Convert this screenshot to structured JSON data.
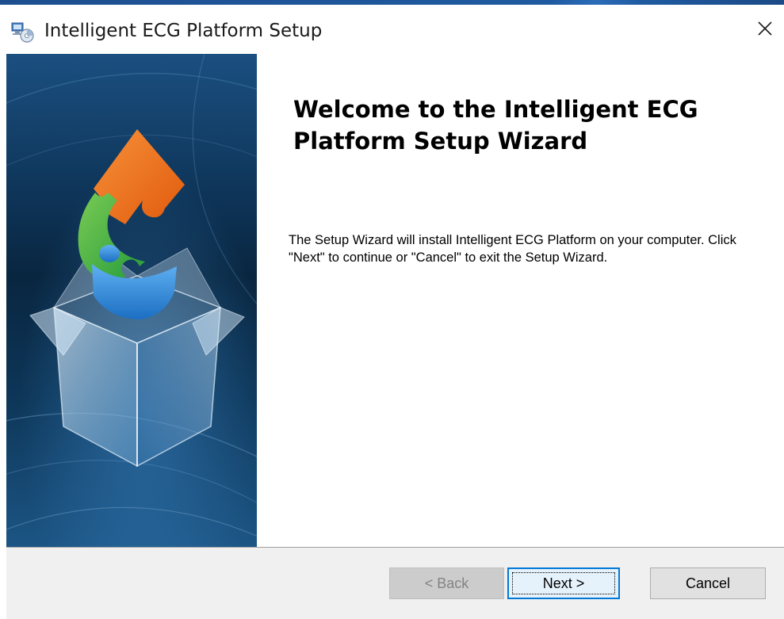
{
  "window": {
    "title": "Intelligent ECG Platform Setup",
    "app_icon": "installer-icon",
    "close_icon": "close-icon"
  },
  "main": {
    "heading": "Welcome to the Intelligent ECG Platform Setup Wizard",
    "description": "The Setup Wizard will install Intelligent ECG Platform on your computer.  Click \"Next\" to continue or \"Cancel\" to exit the Setup Wizard."
  },
  "buttons": {
    "back": {
      "label": "< Back",
      "enabled": false
    },
    "next": {
      "label": "Next >",
      "enabled": true,
      "focused": true
    },
    "cancel": {
      "label": "Cancel",
      "enabled": true
    }
  },
  "colors": {
    "accent": "#0078d7",
    "banner_dark": "#0a2a4a",
    "puzzle_orange": "#ee6a1a",
    "puzzle_green": "#3fae49",
    "puzzle_blue": "#2b86d6"
  }
}
